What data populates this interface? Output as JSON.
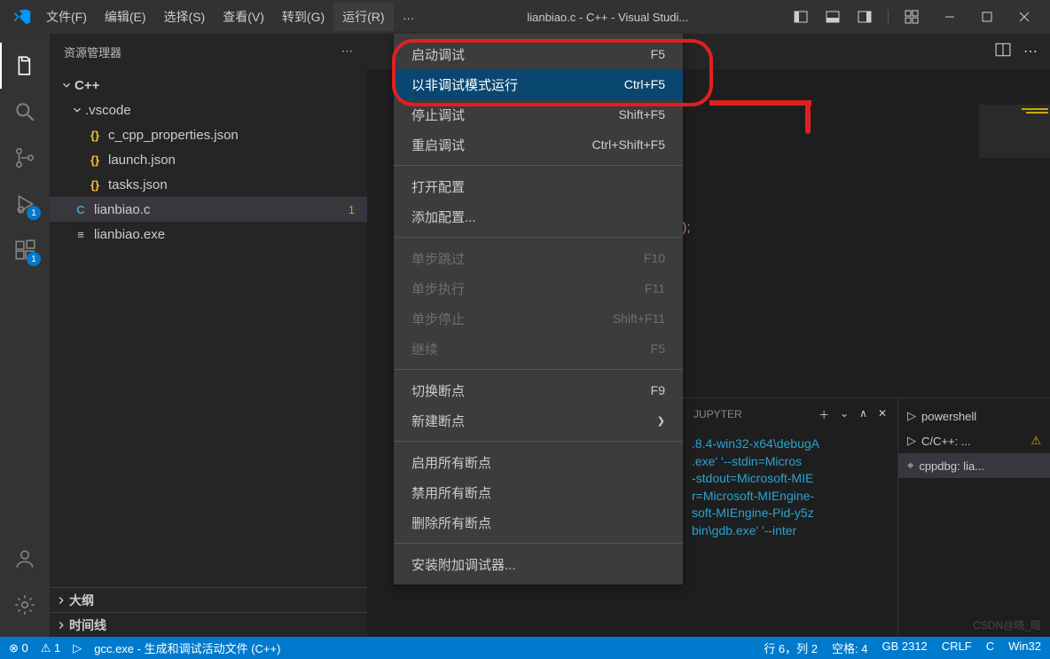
{
  "titlebar": {
    "menus": [
      "文件(F)",
      "编辑(E)",
      "选择(S)",
      "查看(V)",
      "转到(G)",
      "运行(R)",
      "…"
    ],
    "title": "lianbiao.c - C++ - Visual Studi..."
  },
  "sidebar": {
    "header": "资源管理器",
    "root": "C++",
    "folder": ".vscode",
    "files": [
      {
        "name": "c_cpp_properties.json",
        "icon": "{}"
      },
      {
        "name": "launch.json",
        "icon": "{}"
      },
      {
        "name": "tasks.json",
        "icon": "{}"
      }
    ],
    "rootFiles": [
      {
        "name": "lianbiao.c",
        "icon": "C",
        "modified": "1"
      },
      {
        "name": "lianbiao.exe",
        "icon": "≡"
      }
    ],
    "sections": [
      "大纲",
      "时间线"
    ]
  },
  "activity": {
    "debug_badge": "1",
    "ext_badge": "1"
  },
  "dropdown": {
    "items": [
      {
        "label": "启动调试",
        "shortcut": "F5",
        "type": "item"
      },
      {
        "label": "以非调试模式运行",
        "shortcut": "Ctrl+F5",
        "type": "highlighted"
      },
      {
        "label": "停止调试",
        "shortcut": "Shift+F5",
        "type": "item"
      },
      {
        "label": "重启调试",
        "shortcut": "Ctrl+Shift+F5",
        "type": "item"
      },
      {
        "type": "sep"
      },
      {
        "label": "打开配置",
        "shortcut": "",
        "type": "item"
      },
      {
        "label": "添加配置...",
        "shortcut": "",
        "type": "item"
      },
      {
        "type": "sep"
      },
      {
        "label": "单步跳过",
        "shortcut": "F10",
        "type": "disabled"
      },
      {
        "label": "单步执行",
        "shortcut": "F11",
        "type": "disabled"
      },
      {
        "label": "单步停止",
        "shortcut": "Shift+F11",
        "type": "disabled"
      },
      {
        "label": "继续",
        "shortcut": "F5",
        "type": "disabled"
      },
      {
        "type": "sep"
      },
      {
        "label": "切换断点",
        "shortcut": "F9",
        "type": "item"
      },
      {
        "label": "新建断点",
        "shortcut": "",
        "type": "item",
        "chevron": true
      },
      {
        "type": "sep"
      },
      {
        "label": "启用所有断点",
        "shortcut": "",
        "type": "item"
      },
      {
        "label": "禁用所有断点",
        "shortcut": "",
        "type": "item"
      },
      {
        "label": "删除所有断点",
        "shortcut": "",
        "type": "item"
      },
      {
        "type": "sep"
      },
      {
        "label": "安装附加调试器...",
        "shortcut": "",
        "type": "item"
      }
    ]
  },
  "editor": {
    "code_fragment": "\");"
  },
  "panel": {
    "tab": "JUPYTER",
    "terminal_lines": [
      ".8.4-win32-x64\\debugA",
      ".exe' '--stdin=Micros",
      "-stdout=Microsoft-MIE",
      "r=Microsoft-MIEngine-",
      "soft-MIEngine-Pid-y5z",
      "bin\\gdb.exe' '--inter"
    ],
    "terminals": [
      {
        "icon": "▷",
        "label": "powershell"
      },
      {
        "icon": "▷",
        "label": "C/C++: ...",
        "warn": true
      },
      {
        "icon": "⌖",
        "label": "cppdbg: lia..."
      }
    ]
  },
  "statusbar": {
    "errors": "⊗ 0",
    "warnings": "⚠ 1",
    "debug_config": "gcc.exe - 生成和调试活动文件 (C++)",
    "position": "行 6，列 2",
    "indent": "空格: 4",
    "encoding": "GB 2312",
    "eol": "CRLF",
    "lang": "C",
    "platform": "Win32"
  },
  "watermark": "CSDN@晓_暄"
}
